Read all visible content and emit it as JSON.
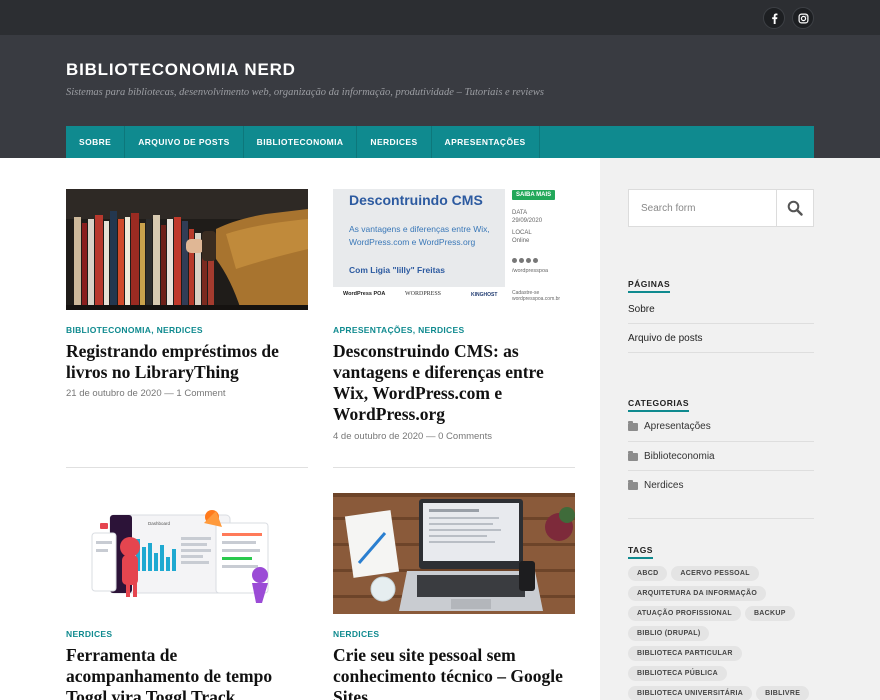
{
  "social": [
    "facebook-icon",
    "instagram-icon"
  ],
  "site": {
    "title": "BIBLIOTECONOMIA NERD",
    "description": "Sistemas para bibliotecas, desenvolvimento web, organização da informação, produtividade – Tutoriais e reviews"
  },
  "nav": [
    "SOBRE",
    "ARQUIVO DE POSTS",
    "BIBLIOTECONOMIA",
    "NERDICES",
    "APRESENTAÇÕES"
  ],
  "posts": [
    {
      "categories": "BIBLIOTECONOMIA, NERDICES",
      "title": "Registrando empréstimos de livros no LibraryThing",
      "date": "21 de outubro de 2020",
      "comments": "1 Comment"
    },
    {
      "categories": "APRESENTAÇÕES, NERDICES",
      "title": "Desconstruindo CMS: as vantagens e diferenças entre Wix, WordPress.com e WordPress.org",
      "date": "4 de outubro de 2020",
      "comments": "0 Comments",
      "thumb": {
        "heading": "Descontruindo CMS",
        "subtitle": "As vantagens e diferenças entre Wix, WordPress.com e WordPress.org",
        "author": "Com Ligia \"lilly\" Freitas",
        "badge": "SAIBA MAIS",
        "data_label": "DATA",
        "date": "29/09/2020",
        "local_label": "LOCAL",
        "local": "Online",
        "handle": "/wordpresspoa",
        "logos": [
          "WordPress POA",
          "WORDPRESS",
          "KINGHOST"
        ],
        "signup": "Cadastre-se wordpresspoa.com.br"
      }
    },
    {
      "categories": "NERDICES",
      "title": "Ferramenta de acompanhamento de tempo Toggl vira Toggl Track",
      "thumb": {
        "panel": "Dashboard"
      }
    },
    {
      "categories": "NERDICES",
      "title": "Crie seu site pessoal sem conhecimento técnico – Google Sites"
    }
  ],
  "meta_sep": "—",
  "sidebar": {
    "search_placeholder": "Search form",
    "pages_title": "PÁGINAS",
    "pages": [
      "Sobre",
      "Arquivo de posts"
    ],
    "categories_title": "CATEGORIAS",
    "categories": [
      "Apresentações",
      "Biblioteconomia",
      "Nerdices"
    ],
    "tags_title": "TAGS",
    "tags": [
      "ABCD",
      "ACERVO PESSOAL",
      "ARQUITETURA DA INFORMAÇÃO",
      "ATUAÇÃO PROFISSIONAL",
      "BACKUP",
      "BIBLIO (DRUPAL)",
      "BIBLIOTECA PARTICULAR",
      "BIBLIOTECA PÚBLICA",
      "BIBLIOTECA UNIVERSITÁRIA",
      "BIBLIVRE"
    ]
  }
}
